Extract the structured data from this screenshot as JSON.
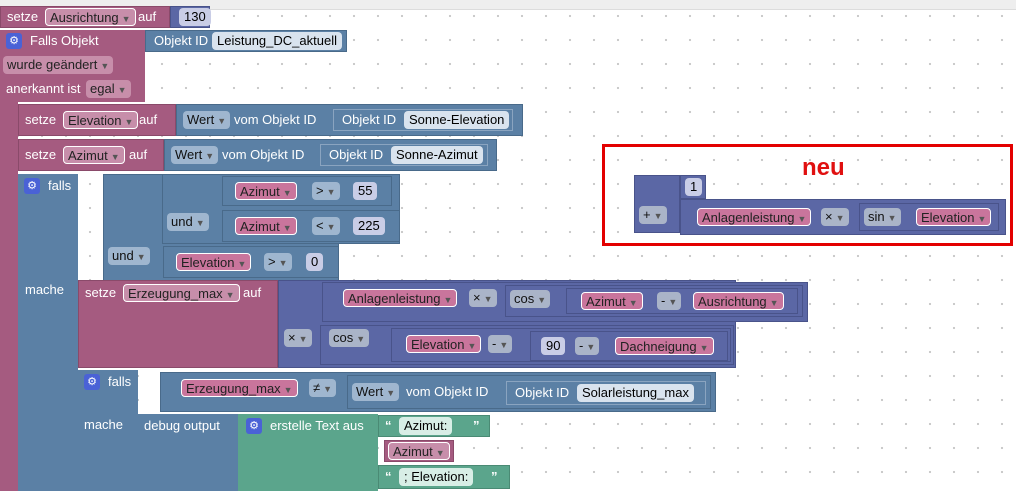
{
  "window": {
    "title": ""
  },
  "blocks": {
    "set_ausrichtung": {
      "setze": "setze",
      "var": "Ausrichtung",
      "auf": "auf",
      "value": "130"
    },
    "if_object": {
      "title": "Falls Objekt",
      "objid_label": "Objekt ID",
      "objid": "Leistung_DC_aktuell",
      "changed": "wurde geändert",
      "ack_label": "anerkannt ist",
      "ack": "egal"
    },
    "set_elevation": {
      "setze": "setze",
      "var": "Elevation",
      "auf": "auf",
      "wert": "Wert",
      "vom": "vom Objekt ID",
      "objid_label": "Objekt ID",
      "objid": "Sonne-Elevation"
    },
    "set_azimut": {
      "setze": "setze",
      "var": "Azimut",
      "auf": "auf",
      "wert": "Wert",
      "vom": "vom Objekt ID",
      "objid_label": "Objekt ID",
      "objid": "Sonne-Azimut"
    },
    "if1": {
      "falls": "falls",
      "cond1_var": "Azimut",
      "cond1_op": ">",
      "cond1_val": "55",
      "und1": "und",
      "cond2_var": "Azimut",
      "cond2_op": "<",
      "cond2_val": "225",
      "und2": "und",
      "cond3_var": "Elevation",
      "cond3_op": ">",
      "cond3_val": "0",
      "mache": "mache"
    },
    "set_erzeugung": {
      "setze": "setze",
      "var": "Erzeugung_max",
      "auf": "auf",
      "a": "Anlagenleistung",
      "times": "×",
      "cos": "cos",
      "az": "Azimut",
      "minus": "-",
      "aus": "Ausrichtung",
      "times2": "×",
      "cos2": "cos",
      "elev": "Elevation",
      "minus2": "-",
      "ninety": "90",
      "minus3": "-",
      "dach": "Dachneigung"
    },
    "if2": {
      "falls": "falls",
      "var": "Erzeugung_max",
      "op": "≠",
      "wert": "Wert",
      "vom": "vom Objekt ID",
      "objid_label": "Objekt ID",
      "objid": "Solarleistung_max",
      "mache": "mache"
    },
    "debug": {
      "label": "debug output",
      "text": "erstelle Text aus",
      "s1": "Azimut:",
      "var1": "Azimut",
      "s2": "; Elevation:"
    }
  },
  "floating": {
    "label": "neu",
    "one": "1",
    "plus": "+",
    "a": "Anlagenleistung",
    "times": "×",
    "sin": "sin",
    "elev": "Elevation"
  },
  "colors": {
    "variable": "#a55b80",
    "math": "#5b67a5",
    "logic": "#5b80a5",
    "text": "#5ba58c",
    "highlight": "#e30000"
  }
}
